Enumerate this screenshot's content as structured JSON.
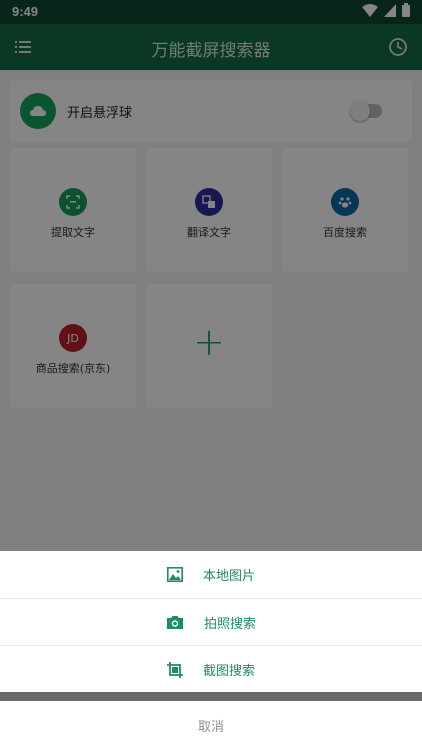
{
  "status_bar": {
    "time": "9:49"
  },
  "app_bar": {
    "title": "万能截屏搜索器"
  },
  "floating_ball": {
    "label": "开启悬浮球",
    "enabled": false
  },
  "tools": [
    {
      "label": "提取文字",
      "icon": "text-scan-icon",
      "color": "#1a9c5e"
    },
    {
      "label": "翻译文字",
      "icon": "translate-icon",
      "color": "#2c2f9c"
    },
    {
      "label": "百度搜索",
      "icon": "baidu-paw-icon",
      "color": "#0d6aa5"
    },
    {
      "label": "商品搜索(京东)",
      "icon": "jd-icon",
      "icon_text": "JD",
      "color": "#b62229"
    }
  ],
  "bottom_sheet": {
    "items": [
      {
        "label": "本地图片",
        "icon": "image-icon"
      },
      {
        "label": "拍照搜索",
        "icon": "camera-icon"
      },
      {
        "label": "截图搜索",
        "icon": "crop-icon"
      }
    ],
    "cancel_label": "取消"
  },
  "colors": {
    "primary": "#146c45",
    "accent": "#16a35f"
  }
}
